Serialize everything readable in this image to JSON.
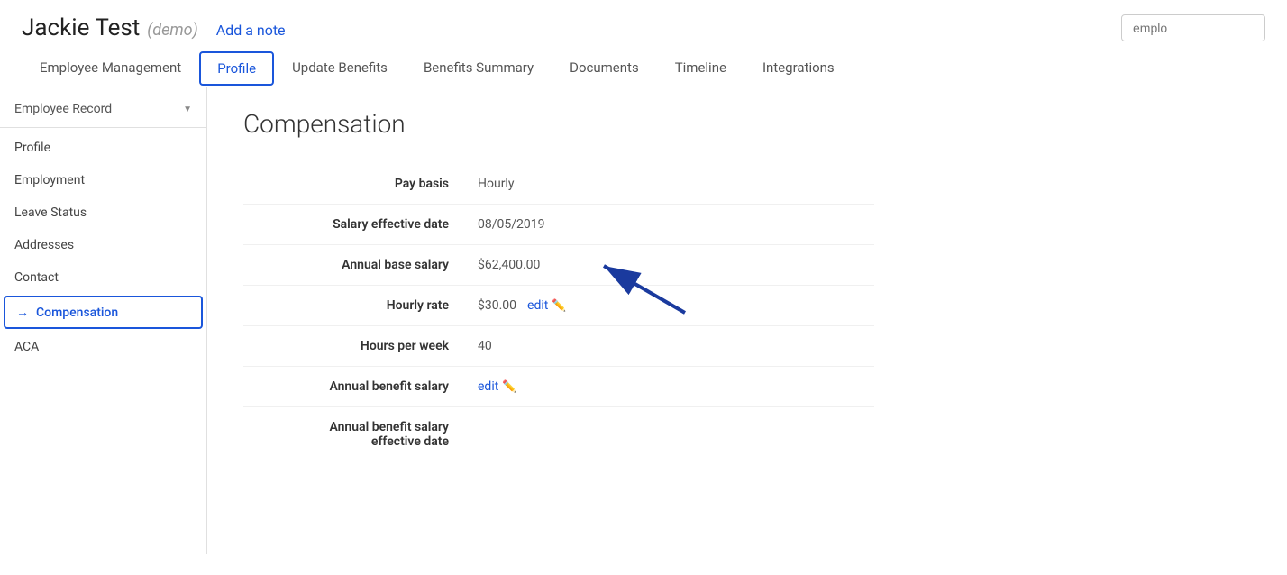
{
  "header": {
    "employee_name": "Jackie Test",
    "demo_label": "(demo)",
    "add_note_label": "Add a note",
    "search_placeholder": "emplo"
  },
  "nav": {
    "tabs": [
      {
        "id": "employee-management",
        "label": "Employee Management",
        "active": false
      },
      {
        "id": "profile",
        "label": "Profile",
        "active": true
      },
      {
        "id": "update-benefits",
        "label": "Update Benefits",
        "active": false
      },
      {
        "id": "benefits-summary",
        "label": "Benefits Summary",
        "active": false
      },
      {
        "id": "documents",
        "label": "Documents",
        "active": false
      },
      {
        "id": "timeline",
        "label": "Timeline",
        "active": false
      },
      {
        "id": "integrations",
        "label": "Integrations",
        "active": false
      }
    ]
  },
  "sidebar": {
    "section_header": "Employee Record",
    "items": [
      {
        "id": "profile",
        "label": "Profile",
        "active": false,
        "arrow": false
      },
      {
        "id": "employment",
        "label": "Employment",
        "active": false,
        "arrow": false
      },
      {
        "id": "leave-status",
        "label": "Leave Status",
        "active": false,
        "arrow": false
      },
      {
        "id": "addresses",
        "label": "Addresses",
        "active": false,
        "arrow": false
      },
      {
        "id": "contact",
        "label": "Contact",
        "active": false,
        "arrow": false
      },
      {
        "id": "compensation",
        "label": "Compensation",
        "active": true,
        "arrow": true
      },
      {
        "id": "aca",
        "label": "ACA",
        "active": false,
        "arrow": false
      }
    ]
  },
  "compensation": {
    "title": "Compensation",
    "fields": [
      {
        "id": "pay-basis",
        "label": "Pay basis",
        "value": "Hourly",
        "editable": false
      },
      {
        "id": "salary-effective-date",
        "label": "Salary effective date",
        "value": "08/05/2019",
        "editable": false
      },
      {
        "id": "annual-base-salary",
        "label": "Annual base salary",
        "value": "$62,400.00",
        "editable": false
      },
      {
        "id": "hourly-rate",
        "label": "Hourly rate",
        "value": "$30.00",
        "editable": true,
        "edit_label": "edit"
      },
      {
        "id": "hours-per-week",
        "label": "Hours per week",
        "value": "40",
        "editable": false
      },
      {
        "id": "annual-benefit-salary",
        "label": "Annual benefit salary",
        "value": "",
        "editable": true,
        "edit_label": "edit"
      },
      {
        "id": "annual-benefit-salary-effective-date",
        "label": "Annual benefit salary effective date",
        "value": "",
        "editable": false
      }
    ]
  }
}
